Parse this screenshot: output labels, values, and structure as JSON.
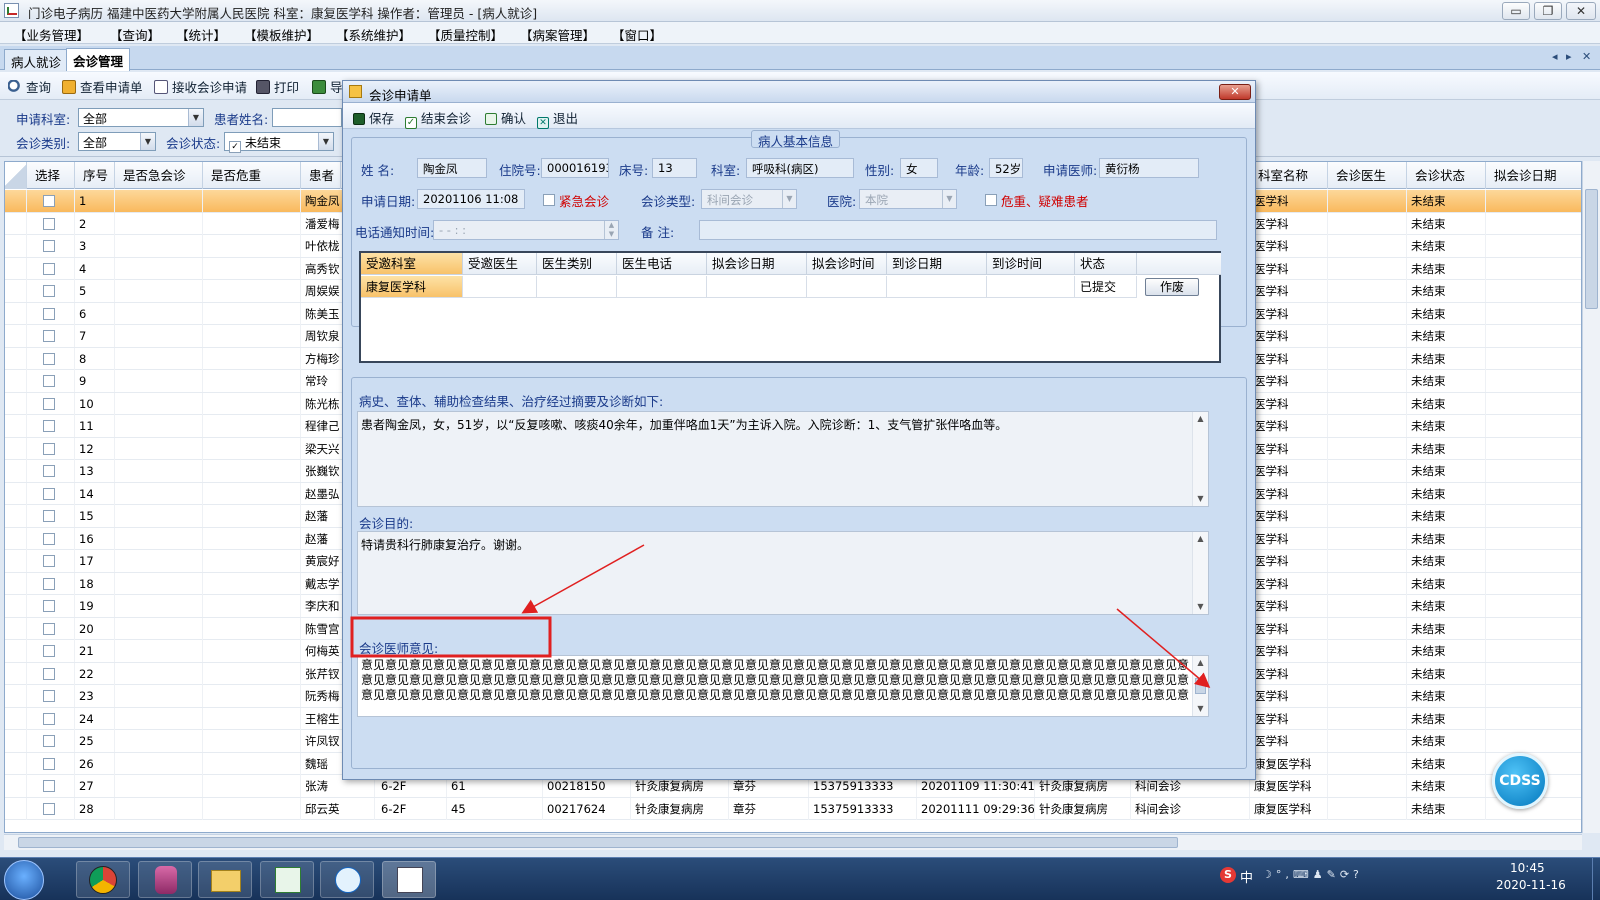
{
  "window": {
    "title": "门诊电子病历  福建中医药大学附属人民医院  科室：康复医学科  操作者：管理员 - [病人就诊]",
    "btn_min": "▭",
    "btn_restore": "❐",
    "btn_close": "✕"
  },
  "menu": [
    "【业务管理】",
    "【查询】",
    "【统计】",
    "【模板维护】",
    "【系统维护】",
    "【质量控制】",
    "【病案管理】",
    "【窗口】"
  ],
  "tabs": [
    "病人就诊",
    "会诊管理"
  ],
  "tab_nav": {
    "left": "◂",
    "right": "▸",
    "close": "✕"
  },
  "toolbar": [
    "查询",
    "查看申请单",
    "接收会诊申请",
    "打印",
    "导"
  ],
  "filters": {
    "dept_label": "申请科室:",
    "dept_value": "全部",
    "name_label": "患者姓名:",
    "type_label": "会诊类别:",
    "type_value": "全部",
    "status_label": "会诊状态:",
    "status_value": "未结束"
  },
  "grid": {
    "headers_left": [
      "选择",
      "序号",
      "是否急会诊",
      "是否危重",
      "患者"
    ],
    "headers_right": [
      "科室名称",
      "会诊医生",
      "会诊状态",
      "拟会诊日期"
    ],
    "rows": [
      {
        "no": "1",
        "name": "陶金凤",
        "dept": "医学科",
        "status": "未结束"
      },
      {
        "no": "2",
        "name": "潘爱梅",
        "dept": "医学科",
        "status": "未结束"
      },
      {
        "no": "3",
        "name": "叶依栊",
        "dept": "医学科",
        "status": "未结束"
      },
      {
        "no": "4",
        "name": "高秀钦",
        "dept": "医学科",
        "status": "未结束"
      },
      {
        "no": "5",
        "name": "周娱娱",
        "dept": "医学科",
        "status": "未结束"
      },
      {
        "no": "6",
        "name": "陈美玉",
        "dept": "医学科",
        "status": "未结束"
      },
      {
        "no": "7",
        "name": "周钦泉",
        "dept": "医学科",
        "status": "未结束"
      },
      {
        "no": "8",
        "name": "方梅珍",
        "dept": "医学科",
        "status": "未结束"
      },
      {
        "no": "9",
        "name": "常玲",
        "dept": "医学科",
        "status": "未结束"
      },
      {
        "no": "10",
        "name": "陈光栋",
        "dept": "医学科",
        "status": "未结束"
      },
      {
        "no": "11",
        "name": "程律己",
        "dept": "医学科",
        "status": "未结束"
      },
      {
        "no": "12",
        "name": "梁天兴",
        "dept": "医学科",
        "status": "未结束"
      },
      {
        "no": "13",
        "name": "张巍钦",
        "dept": "医学科",
        "status": "未结束"
      },
      {
        "no": "14",
        "name": "赵墨弘",
        "dept": "医学科",
        "status": "未结束"
      },
      {
        "no": "15",
        "name": "赵藩",
        "dept": "医学科",
        "status": "未结束"
      },
      {
        "no": "16",
        "name": "赵藩",
        "dept": "医学科",
        "status": "未结束"
      },
      {
        "no": "17",
        "name": "黄宸好",
        "dept": "医学科",
        "status": "未结束"
      },
      {
        "no": "18",
        "name": "戴志学",
        "dept": "医学科",
        "status": "未结束"
      },
      {
        "no": "19",
        "name": "李庆和",
        "dept": "医学科",
        "status": "未结束"
      },
      {
        "no": "20",
        "name": "陈雪宫",
        "dept": "医学科",
        "status": "未结束"
      },
      {
        "no": "21",
        "name": "何梅英",
        "dept": "医学科",
        "status": "未结束"
      },
      {
        "no": "22",
        "name": "张芹钗",
        "dept": "医学科",
        "status": "未结束"
      },
      {
        "no": "23",
        "name": "阮秀梅",
        "dept": "医学科",
        "status": "未结束"
      },
      {
        "no": "24",
        "name": "王榕生",
        "dept": "医学科",
        "status": "未结束"
      },
      {
        "no": "25",
        "name": "许凤钗",
        "dept": "医学科",
        "status": "未结束"
      },
      {
        "no": "26",
        "name": "魏瑶",
        "dept": "康复医学科",
        "status": "未结束"
      },
      {
        "no": "27",
        "name": "张涛",
        "dept": "康复医学科",
        "status": "未结束"
      },
      {
        "no": "28",
        "name": "邱云英",
        "dept": "康复医学科",
        "status": "未结束"
      }
    ],
    "extra_rows": [
      {
        "bed": "6-2F",
        "age": "61",
        "id": "00218150",
        "ward": "针灸康复病房",
        "doc": "章芬",
        "phone": "15375913333",
        "time": "20201109 11:30:41",
        "ward2": "针灸康复病房",
        "type": "科间会诊"
      },
      {
        "bed": "6-2F",
        "age": "45",
        "id": "00217624",
        "ward": "针灸康复病房",
        "doc": "章芬",
        "phone": "15375913333",
        "time": "20201111 09:29:36",
        "ward2": "针灸康复病房",
        "type": "科间会诊"
      }
    ]
  },
  "dialog": {
    "title": "会诊申请单",
    "close": "✕",
    "tools": [
      "保存",
      "结束会诊",
      "确认",
      "退出"
    ],
    "section_title": "病人基本信息",
    "labels": {
      "name": "姓    名:",
      "inpatient_no": "住院号:",
      "bed_no": "床号:",
      "dept": "科室:",
      "sex": "性别:",
      "age": "年龄:",
      "doctor": "申请医师:",
      "apply_date": "申请日期:",
      "urgent": "紧急会诊",
      "consult_type": "会诊类型:",
      "hospital": "医院:",
      "critical": "危重、疑难患者",
      "phone_time": "电话通知时间:",
      "remark": "备    注:"
    },
    "values": {
      "name": "陶金凤",
      "inpatient_no": "0000161933",
      "bed_no": "13",
      "dept": "呼吸科(病区)",
      "sex": "女",
      "age": "52岁",
      "doctor": "黄衍杨",
      "apply_date": "20201106  11:08",
      "consult_type": "科间会诊",
      "hospital": "本院",
      "phone_time": "-  -       :  :"
    },
    "sub_headers": [
      "受邀科室",
      "受邀医生",
      "医生类别",
      "医生电话",
      "拟会诊日期",
      "拟会诊时间",
      "到诊日期",
      "到诊时间",
      "状态"
    ],
    "sub_row": {
      "dept": "康复医学科",
      "status": "已提交",
      "btn": "作废"
    },
    "history_label": "病史、查体、辅助检查结果、治疗经过摘要及诊断如下:",
    "history_text": "患者陶金凤，女，51岁，以“反复咳嗽、咳痰40余年，加重伴咯血1天”为主诉入院。入院诊断：1、支气管扩张伴咯血等。",
    "purpose_label": "会诊目的:",
    "purpose_text": "特请贵科行肺康复治疗。谢谢。",
    "opinion_label": "会诊医师意见:",
    "opinion_lines": [
      "意见意见意见意见意见意见意见意见意见意见意见意见意见意见意见意见意见意见意见意见意见意见意见意见意见意见意见意见意见意见意见意见意见意见意见意见意见",
      "意见意见意见意见意见意见意见意见意见意见意见意见意见意见意见意见意见意见意见意见意见意见意见意见意见意见意见意见意见意见意见意见意见意见意见意见意见",
      "意见意见意见意见意见意见意见意见意见意见意见意见意见意见意见意见意见意见意见意见意见意见意见意见意见意见意见意见意见意见意见意见意见意见意见意见意见"
    ]
  },
  "annotation_color": "#e02020",
  "cdss": "CDSS",
  "tray": {
    "ime": "中",
    "time": "10:45",
    "date": "2020-11-16"
  }
}
